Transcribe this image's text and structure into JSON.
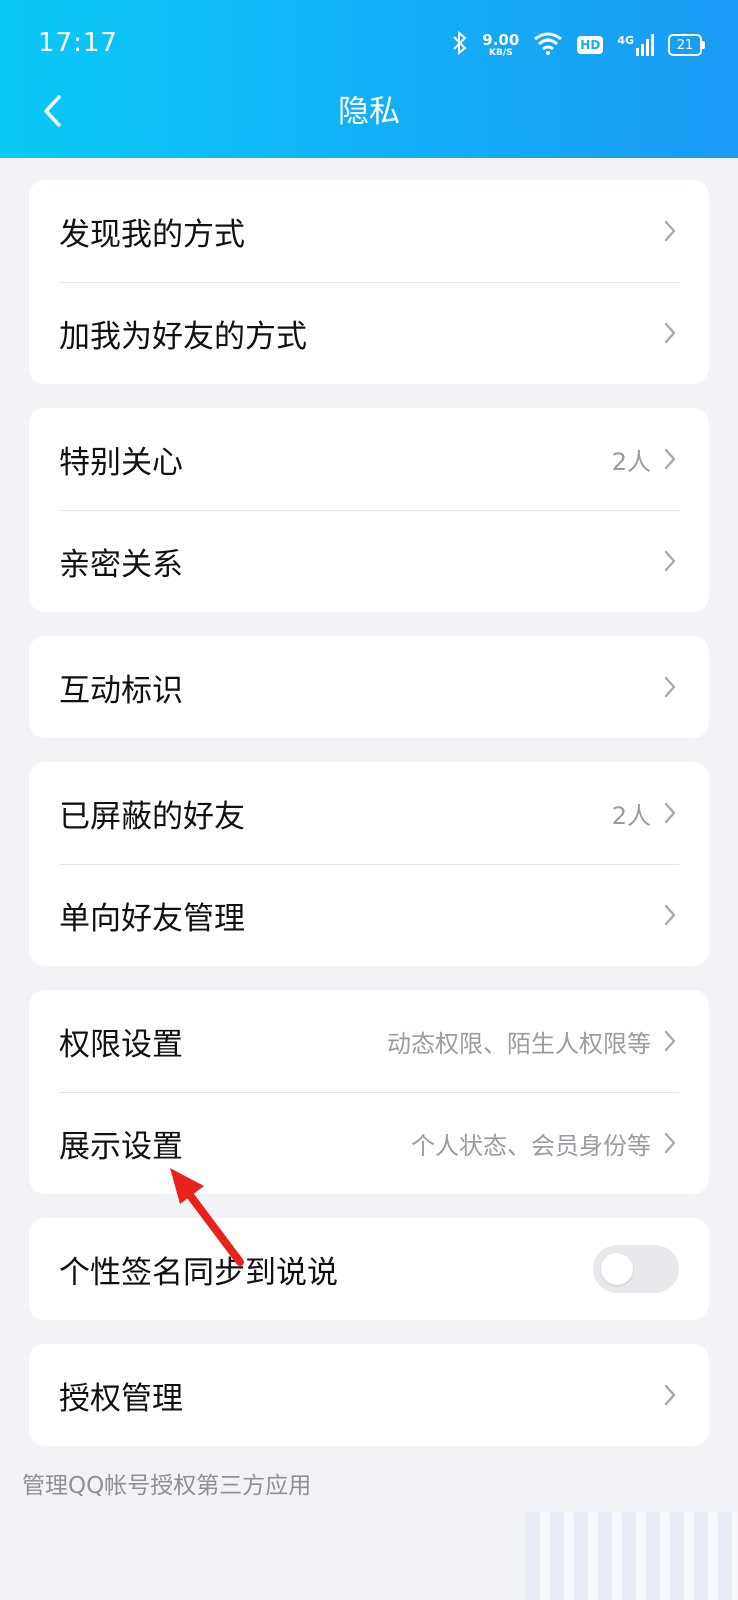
{
  "status_bar": {
    "time": "17:17",
    "net_speed": "9.00",
    "net_speed_unit": "KB/S",
    "hd": "HD",
    "signal_label": "4G",
    "battery": "21",
    "icons": [
      "bluetooth-icon",
      "wifi-icon",
      "signal-icon",
      "battery-icon"
    ]
  },
  "nav": {
    "title": "隐私",
    "back_icon": "chevron-left-icon"
  },
  "groups": [
    {
      "rows": [
        {
          "label": "发现我的方式"
        },
        {
          "label": "加我为好友的方式"
        }
      ]
    },
    {
      "rows": [
        {
          "label": "特别关心",
          "value": "2人"
        },
        {
          "label": "亲密关系"
        }
      ]
    },
    {
      "rows": [
        {
          "label": "互动标识"
        }
      ]
    },
    {
      "rows": [
        {
          "label": "已屏蔽的好友",
          "value": "2人"
        },
        {
          "label": "单向好友管理"
        }
      ]
    },
    {
      "rows": [
        {
          "label": "权限设置",
          "value": "动态权限、陌生人权限等"
        },
        {
          "label": "展示设置",
          "value": "个人状态、会员身份等"
        }
      ]
    },
    {
      "rows": [
        {
          "label": "个性签名同步到说说",
          "toggle": false
        }
      ]
    },
    {
      "rows": [
        {
          "label": "授权管理"
        }
      ]
    }
  ],
  "footnote": "管理QQ帐号授权第三方应用",
  "colors": {
    "header_gradient": [
      "#0bc9f5",
      "#1a9bf6"
    ],
    "background": "#f2f3f7",
    "annotation_arrow": "#e8221b"
  }
}
